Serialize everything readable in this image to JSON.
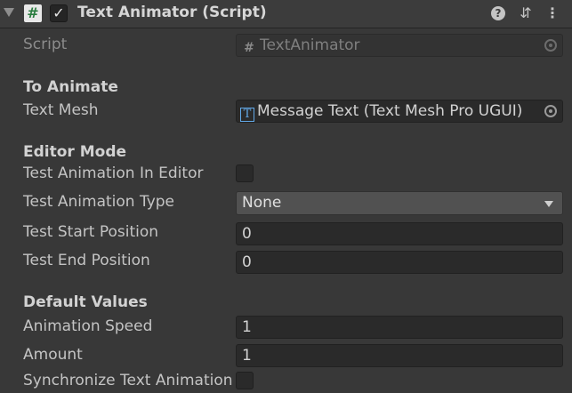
{
  "component": {
    "title": "Text Animator (Script)",
    "enabled": true,
    "icons": [
      "foldout-arrow-icon",
      "script-icon",
      "help-icon",
      "preset-icon",
      "context-menu-icon"
    ]
  },
  "script_row": {
    "label": "Script",
    "value": "TextAnimator"
  },
  "sections": {
    "to_animate": "To Animate",
    "editor_mode": "Editor Mode",
    "default_values": "Default Values"
  },
  "fields": {
    "text_mesh": {
      "label": "Text Mesh",
      "value": "Message Text (Text Mesh Pro UGUI)"
    },
    "test_animation_in_editor": {
      "label": "Test Animation In Editor",
      "checked": false
    },
    "test_animation_type": {
      "label": "Test Animation Type",
      "value": "None"
    },
    "test_start_position": {
      "label": "Test Start Position",
      "value": "0"
    },
    "test_end_position": {
      "label": "Test End Position",
      "value": "0"
    },
    "animation_speed": {
      "label": "Animation Speed",
      "value": "1"
    },
    "amount": {
      "label": "Amount",
      "value": "1"
    },
    "synchronize_text_animation": {
      "label": "Synchronize Text Animation",
      "checked": false
    }
  },
  "colors": {
    "background": "#383838",
    "header": "#3c3c3c",
    "field": "#2a2a2a",
    "dropdown": "#515151",
    "text": "#c4c4c4",
    "tmp_icon": "#62a8e6"
  }
}
